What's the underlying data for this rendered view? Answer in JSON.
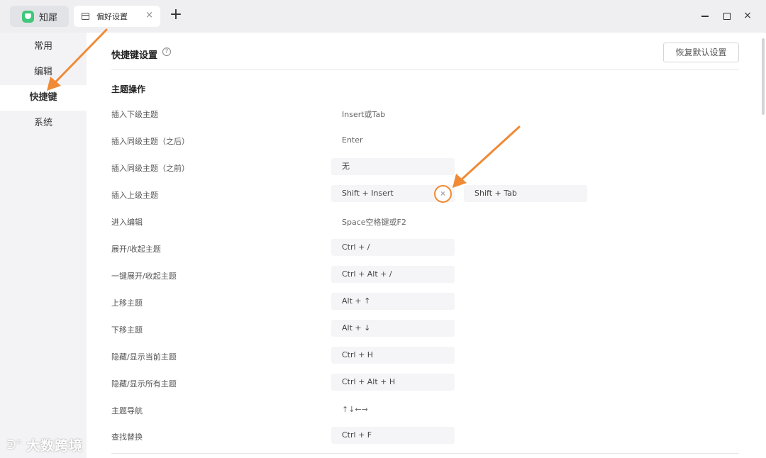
{
  "titlebar": {
    "app_name": "知犀",
    "tab_title": "偏好设置",
    "tab_close": "×",
    "new_tab": "+",
    "window_close": "×"
  },
  "sidebar": {
    "items": [
      {
        "label": "常用",
        "active": false
      },
      {
        "label": "编辑",
        "active": false
      },
      {
        "label": "快捷键",
        "active": true
      },
      {
        "label": "系统",
        "active": false
      }
    ]
  },
  "header": {
    "title": "快捷键设置",
    "help_icon": "?",
    "reset_label": "恢复默认设置"
  },
  "section": {
    "title": "主题操作"
  },
  "shortcuts": [
    {
      "label": "插入下级主题",
      "key": "Insert或Tab",
      "style": "plain"
    },
    {
      "label": "插入同级主题（之后）",
      "key": "Enter",
      "style": "plain"
    },
    {
      "label": "插入同级主题（之前）",
      "key": "无",
      "style": "box"
    },
    {
      "label": "插入上级主题",
      "key": "Shift + Insert",
      "key2": "Shift + Tab",
      "clear": "×",
      "style": "box"
    },
    {
      "label": "进入编辑",
      "key": "Space空格键或F2",
      "style": "plain"
    },
    {
      "label": "展开/收起主题",
      "key": "Ctrl + /",
      "style": "box"
    },
    {
      "label": "一键展开/收起主题",
      "key": "Ctrl + Alt + /",
      "style": "box"
    },
    {
      "label": "上移主题",
      "key": "Alt + ↑",
      "style": "box"
    },
    {
      "label": "下移主题",
      "key": "Alt + ↓",
      "style": "box"
    },
    {
      "label": "隐藏/显示当前主题",
      "key": "Ctrl + H",
      "style": "box"
    },
    {
      "label": "隐藏/显示所有主题",
      "key": "Ctrl + Alt + H",
      "style": "box"
    },
    {
      "label": "主题导航",
      "key": "↑↓←→",
      "style": "plain"
    },
    {
      "label": "查找替换",
      "key": "Ctrl + F",
      "style": "box"
    }
  ],
  "watermark": {
    "text": "大数跨境"
  },
  "colors": {
    "accent_arrow": "#f08a35",
    "logo_green": "#3fc77a"
  }
}
